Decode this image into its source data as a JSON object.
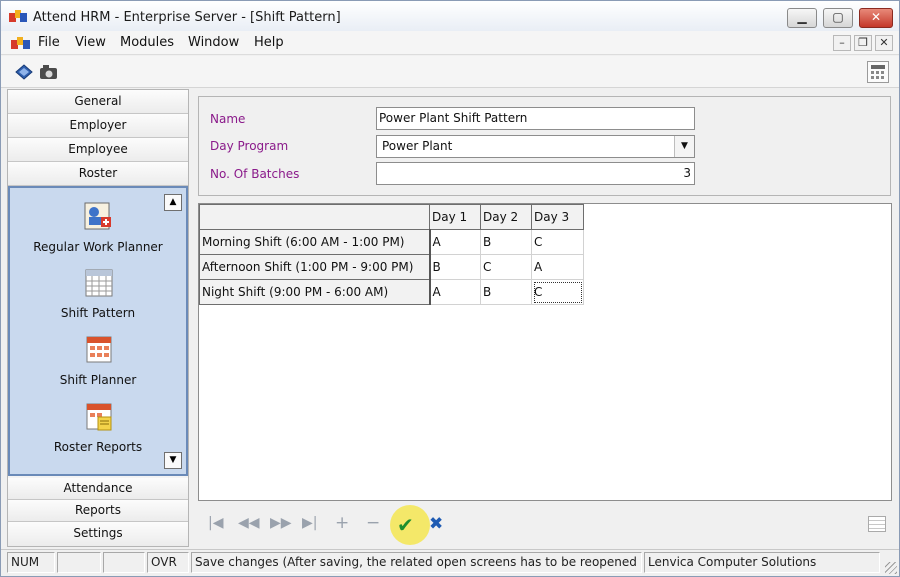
{
  "window": {
    "title": "Attend HRM - Enterprise Server - [Shift Pattern]",
    "minimize": "▁",
    "maximize": "▢",
    "close": "✕"
  },
  "menu": {
    "items": [
      "File",
      "View",
      "Modules",
      "Window",
      "Help"
    ],
    "mdi": {
      "minimize": "–",
      "restore": "❐",
      "close": "✕"
    }
  },
  "sidebar": {
    "top_items": [
      "General",
      "Employer",
      "Employee",
      "Roster"
    ],
    "tiles": [
      {
        "label": "Regular Work Planner",
        "icon": "work-planner-icon"
      },
      {
        "label": "Shift Pattern",
        "icon": "calendar-grid-icon"
      },
      {
        "label": "Shift Planner",
        "icon": "shift-planner-icon"
      },
      {
        "label": "Roster Reports",
        "icon": "reports-icon"
      }
    ],
    "bottom_items": [
      "Attendance",
      "Reports",
      "Settings"
    ],
    "scroll_up": "▲",
    "scroll_down": "▼"
  },
  "form": {
    "name_label": "Name",
    "name_value": "Power Plant Shift Pattern",
    "day_program_label": "Day Program",
    "day_program_value": "Power Plant",
    "dropdown_arrow": "▼",
    "batches_label": "No. Of Batches",
    "batches_value": "3"
  },
  "grid": {
    "columns": [
      "Day 1",
      "Day 2",
      "Day 3"
    ],
    "rows": [
      {
        "label": "Morning Shift (6:00 AM - 1:00 PM)",
        "cells": [
          "A",
          "B",
          "C"
        ]
      },
      {
        "label": "Afternoon Shift (1:00 PM - 9:00 PM)",
        "cells": [
          "B",
          "C",
          "A"
        ]
      },
      {
        "label": "Night Shift (9:00 PM - 6:00 AM)",
        "cells": [
          "A",
          "B",
          "C"
        ]
      }
    ]
  },
  "navigator": {
    "first": "|◀",
    "prev": "◀◀",
    "next": "▶▶",
    "last": "▶|",
    "add": "+",
    "delete": "−",
    "save": "✔",
    "cancel": "✖"
  },
  "status": {
    "num": "NUM",
    "ovr": "OVR",
    "message": "Save changes (After saving, the related open screens has to be reopened fc",
    "company": "Lenvica Computer Solutions"
  }
}
